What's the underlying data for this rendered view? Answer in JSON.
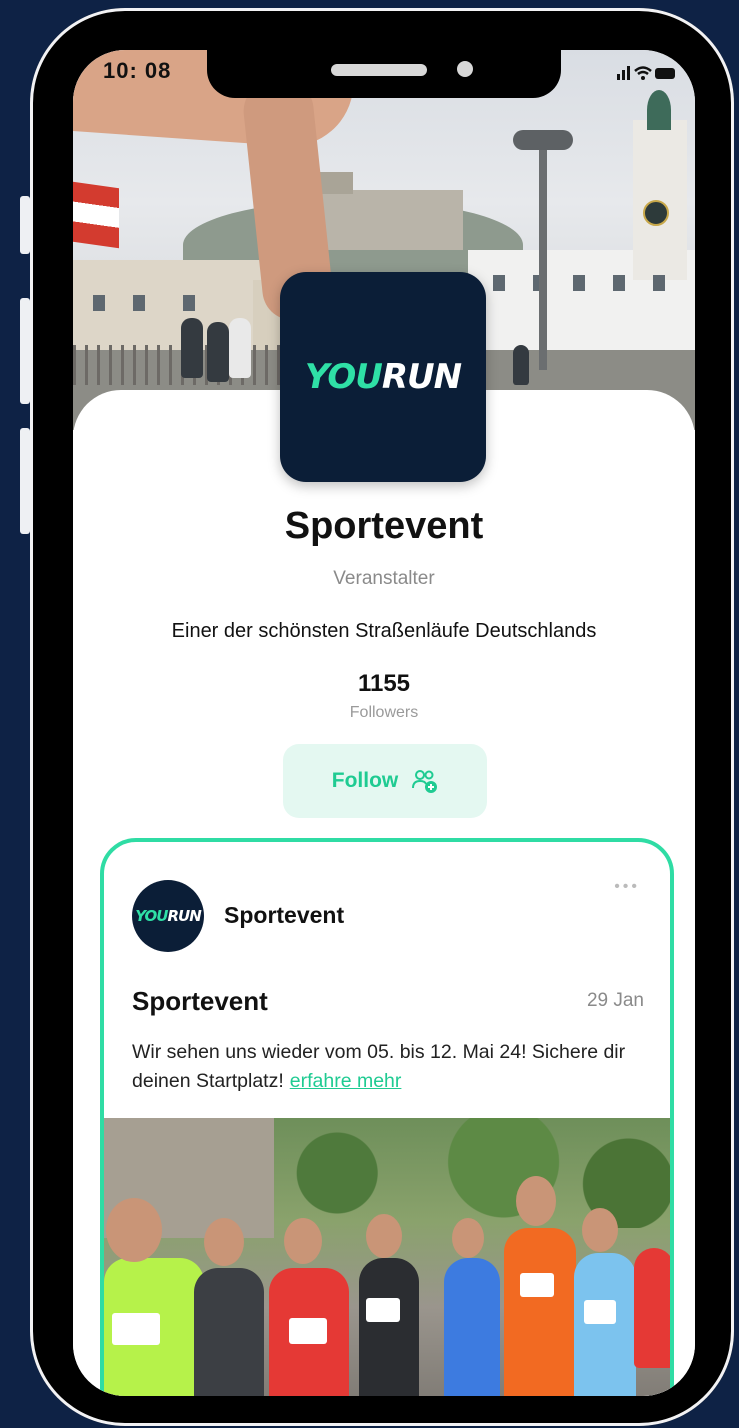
{
  "status_bar": {
    "time": "10: 08",
    "icons": "..ıl • ▬"
  },
  "profile": {
    "logo_you": "YOU",
    "logo_run": "RUN",
    "name": "Sportevent",
    "role": "Veranstalter",
    "description": "Einer der schönsten Straßenläufe Deutschlands",
    "followers_count": "1155",
    "followers_label": "Followers",
    "follow_label": "Follow"
  },
  "post": {
    "author": "Sportevent",
    "avatar_you": "YOU",
    "avatar_run": "RUN",
    "more": "•••",
    "title": "Sportevent",
    "date": "29 Jan",
    "text": "Wir sehen uns wieder vom 05. bis 12. Mai 24! Sichere dir deinen Startplatz!",
    "link": "erfahre mehr"
  },
  "colors": {
    "background": "#0e2245",
    "accent": "#2fdca4",
    "logo_bg": "#0b1e37"
  }
}
